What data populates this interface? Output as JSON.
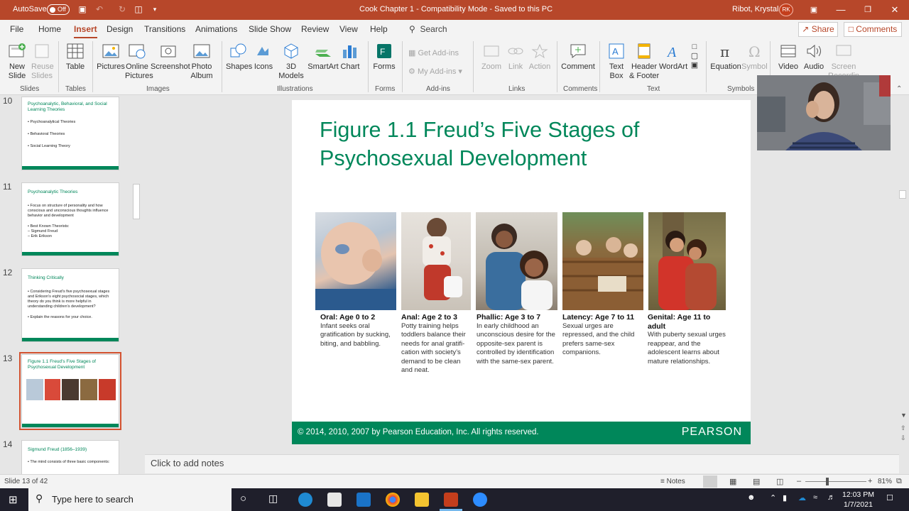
{
  "titlebar": {
    "autosave_label": "AutoSave",
    "autosave_state": "Off",
    "document_title": "Cook Chapter 1  -  Compatibility Mode  -  Saved to this PC",
    "user_name": "Ribot, Krystal",
    "user_initials": "RK"
  },
  "tabs": [
    "File",
    "Home",
    "Insert",
    "Design",
    "Transitions",
    "Animations",
    "Slide Show",
    "Review",
    "View",
    "Help"
  ],
  "active_tab": "Insert",
  "search_label": "Search",
  "share_label": "Share",
  "comments_label": "Comments",
  "ribbon": {
    "new_slide": "New\nSlide",
    "reuse_slides": "Reuse\nSlides",
    "table": "Table",
    "pictures": "Pictures",
    "online_pictures": "Online\nPictures",
    "screenshot": "Screenshot",
    "photo_album": "Photo\nAlbum",
    "shapes": "Shapes",
    "icons": "Icons",
    "models_3d": "3D\nModels",
    "smartart": "SmartArt",
    "chart": "Chart",
    "forms": "Forms",
    "get_addins": "Get Add-ins",
    "my_addins": "My Add-ins",
    "zoom": "Zoom",
    "link": "Link",
    "action": "Action",
    "comment": "Comment",
    "text_box": "Text\nBox",
    "header_footer": "Header\n& Footer",
    "wordart": "WordArt",
    "equation": "Equation",
    "symbol": "Symbol",
    "video": "Video",
    "audio": "Audio",
    "screen_recording": "Screen\nRecording",
    "groups": [
      "Slides",
      "Tables",
      "Images",
      "Illustrations",
      "Forms",
      "Add-ins",
      "Links",
      "Comments",
      "Text",
      "Symbols"
    ]
  },
  "thumbnails": [
    {
      "num": "10",
      "title": "Psychoanalytic, Behavioral, and Social Learning Theories",
      "lines": [
        "• Psychoanalytical Theories",
        "• Behavioral Theories",
        "• Social Learning Theory"
      ]
    },
    {
      "num": "11",
      "title": "Psychoanalytic Theories",
      "lines": [
        "• Focus on structure of personality and how conscious and unconscious thoughts influence behavior and development",
        "• Best Known Theorists:",
        "  – Sigmund Freud",
        "  – Erik Erikson"
      ]
    },
    {
      "num": "12",
      "title": "Thinking Critically",
      "lines": [
        "• Considering Freud’s five psychosexual stages and Erikson’s eight psychosocial stages, which theory do you think is more helpful in understanding children’s development?",
        "• Explain the reasons for your choice."
      ]
    },
    {
      "num": "13",
      "title": "Figure 1.1 Freud’s Five Stages of Psychosexual Development",
      "lines": []
    },
    {
      "num": "14",
      "title": "Sigmund Freud (1856–1939)",
      "lines": [
        "• The mind consists of three basic components:"
      ]
    }
  ],
  "slide": {
    "title": "Figure 1.1 Freud’s Five Stages of Psychosexual Development",
    "stages": [
      {
        "head": "Oral: Age 0 to 2",
        "body": "Infant seeks oral gratification by sucking, biting, and babbling."
      },
      {
        "head": "Anal: Age 2 to 3",
        "body": "Potty training helps toddlers balance their needs for anal gratifi-cation with society’s demand to be clean and neat."
      },
      {
        "head": "Phallic: Age 3 to 7",
        "body": "In early childhood an unconscious desire for the opposite-sex parent is controlled by identification with the same-sex parent."
      },
      {
        "head": "Latency: Age 7 to 11",
        "body": "Sexual urges are repressed, and the child prefers same-sex companions."
      },
      {
        "head": "Genital: Age 11 to adult",
        "body": "With puberty sexual urges reappear, and the adolescent learns about mature relationships."
      }
    ],
    "copyright": "© 2014, 2010, 2007 by Pearson Education, Inc. All rights reserved.",
    "brand": "PEARSON"
  },
  "notes_placeholder": "Click to add notes",
  "status": {
    "slide_info": "Slide 13 of 42",
    "notes_label": "Notes",
    "zoom": "81%"
  },
  "taskbar": {
    "search_placeholder": "Type here to search",
    "time": "12:03 PM",
    "date": "1/7/2021"
  }
}
